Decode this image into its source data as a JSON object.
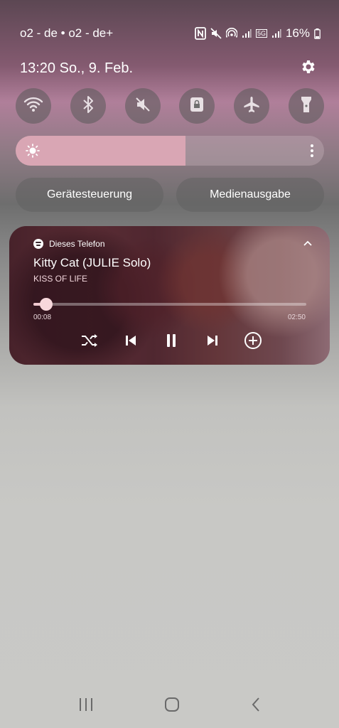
{
  "status": {
    "carrier": "o2 - de • o2 - de+",
    "battery_text": "16%",
    "network_tag": "5G",
    "icons": [
      "nfc-icon",
      "mute-icon",
      "hotspot-icon",
      "signal-icon",
      "battery-icon"
    ]
  },
  "header": {
    "datetime": "13:20  So., 9. Feb.",
    "settings_icon": "gear-icon"
  },
  "quick_tiles": [
    {
      "name": "wifi",
      "icon": "wifi-icon"
    },
    {
      "name": "bluetooth",
      "icon": "bluetooth-icon"
    },
    {
      "name": "sound",
      "icon": "mute-icon"
    },
    {
      "name": "rotation-lock",
      "icon": "lock-icon"
    },
    {
      "name": "airplane",
      "icon": "airplane-icon"
    },
    {
      "name": "flashlight",
      "icon": "flashlight-icon"
    }
  ],
  "brightness": {
    "level": 0.55
  },
  "buttons": {
    "device_control": "Gerätesteuerung",
    "media_output": "Medienausgabe"
  },
  "media": {
    "source": "Dieses Telefon",
    "title": "Kitty Cat (JULIE Solo)",
    "artist": "KISS OF LIFE",
    "elapsed": "00:08",
    "total": "02:50",
    "progress": 0.047
  },
  "colors": {
    "brightness_fill": "#d9a6b4",
    "media_accent": "#f0c8cf"
  }
}
